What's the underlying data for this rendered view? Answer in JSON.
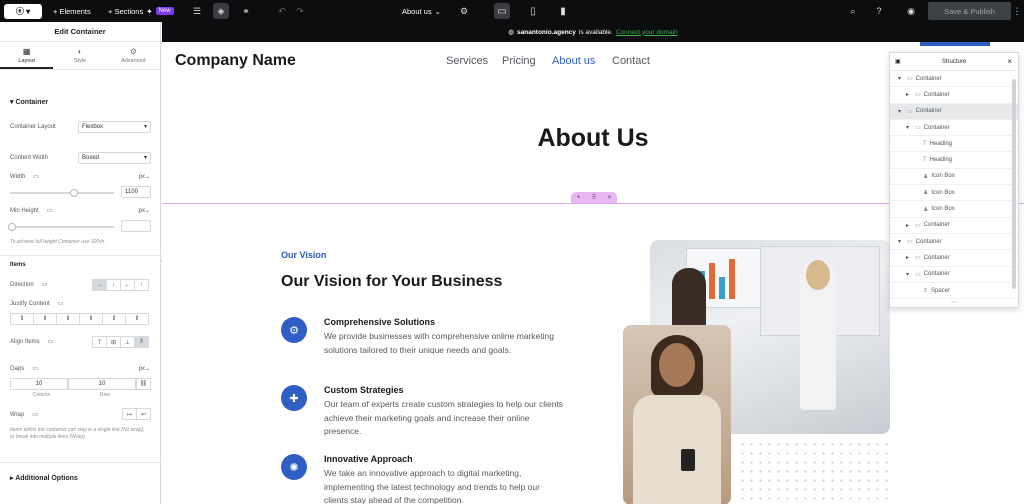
{
  "topbar": {
    "elements_label": "+ Elements",
    "sections_label": "+ Sections",
    "new_badge": "New",
    "page_selector": "About us",
    "publish_label": "Save & Publish"
  },
  "sidebar": {
    "title": "Edit Container",
    "tabs": [
      {
        "label": "Layout",
        "icon": "layout-icon"
      },
      {
        "label": "Style",
        "icon": "style-icon"
      },
      {
        "label": "Advanced",
        "icon": "gear-icon"
      }
    ],
    "section_container": "Container",
    "container_layout_label": "Container Layout",
    "container_layout_value": "Flexbox",
    "content_width_label": "Content Width",
    "content_width_value": "Boxed",
    "width_label": "Width",
    "width_unit": "px",
    "width_value": "1100",
    "width_fraction": 0.62,
    "min_height_label": "Min Height",
    "min_height_unit": "px",
    "min_height_value": "",
    "min_height_hint": "To achieve full height Container use 100vh.",
    "items_heading": "Items",
    "direction_label": "Direction",
    "justify_label": "Justify Content",
    "align_label": "Align Items",
    "gaps_label": "Gaps",
    "gaps_unit": "px",
    "gap_column": "10",
    "gap_row": "10",
    "gap_column_label": "Column",
    "gap_row_label": "Row",
    "wrap_label": "Wrap",
    "wrap_hint": "Items within the container can stay in a single line (No wrap), or break into multiple lines (Wrap).",
    "additional_options": "Additional Options"
  },
  "notice": {
    "domain": "sanantonio.agency",
    "text": "is available.",
    "link": "Connect your domain"
  },
  "site": {
    "company": "Company Name",
    "nav": [
      "Services",
      "Pricing",
      "About us",
      "Contact"
    ],
    "active_nav": "About us",
    "accent": "#2f5fc4",
    "page_title": "About Us",
    "eyebrow": "Our Vision",
    "vision_heading": "Our Vision for Your Business",
    "features": [
      {
        "title": "Comprehensive Solutions",
        "desc": "We provide businesses with comprehensive online marketing solutions tailored to their unique needs and goals.",
        "icon": "gears-icon"
      },
      {
        "title": "Custom Strategies",
        "desc": "Our team of experts create custom strategies to help our clients achieve their marketing goals and increase their online presence.",
        "icon": "puzzle-icon"
      },
      {
        "title": "Innovative Approach",
        "desc": "We take an innovative approach to digital marketing, implementing the latest technology and trends to help our clients stay ahead of the competition.",
        "icon": "lightbulb-icon"
      }
    ]
  },
  "structure": {
    "title": "Structure",
    "items": [
      {
        "label": "Container",
        "depth": 0,
        "arrow": "▾",
        "icon": "container-icon"
      },
      {
        "label": "Container",
        "depth": 1,
        "arrow": "▸",
        "icon": "container-icon"
      },
      {
        "label": "Container",
        "depth": 0,
        "arrow": "▾",
        "icon": "container-icon",
        "selected": true
      },
      {
        "label": "Container",
        "depth": 1,
        "arrow": "▾",
        "icon": "container-icon"
      },
      {
        "label": "Heading",
        "depth": 2,
        "arrow": "",
        "icon": "heading-icon"
      },
      {
        "label": "Heading",
        "depth": 2,
        "arrow": "",
        "icon": "heading-icon"
      },
      {
        "label": "Icon Box",
        "depth": 2,
        "arrow": "",
        "icon": "icon-box-icon"
      },
      {
        "label": "Icon Box",
        "depth": 2,
        "arrow": "",
        "icon": "icon-box-icon"
      },
      {
        "label": "Icon Box",
        "depth": 2,
        "arrow": "",
        "icon": "icon-box-icon"
      },
      {
        "label": "Container",
        "depth": 1,
        "arrow": "▸",
        "icon": "container-icon"
      },
      {
        "label": "Container",
        "depth": 0,
        "arrow": "▾",
        "icon": "container-icon"
      },
      {
        "label": "Container",
        "depth": 1,
        "arrow": "▸",
        "icon": "container-icon"
      },
      {
        "label": "Container",
        "depth": 1,
        "arrow": "▾",
        "icon": "container-icon"
      },
      {
        "label": "Spacer",
        "depth": 2,
        "arrow": "",
        "icon": "spacer-icon"
      }
    ]
  }
}
